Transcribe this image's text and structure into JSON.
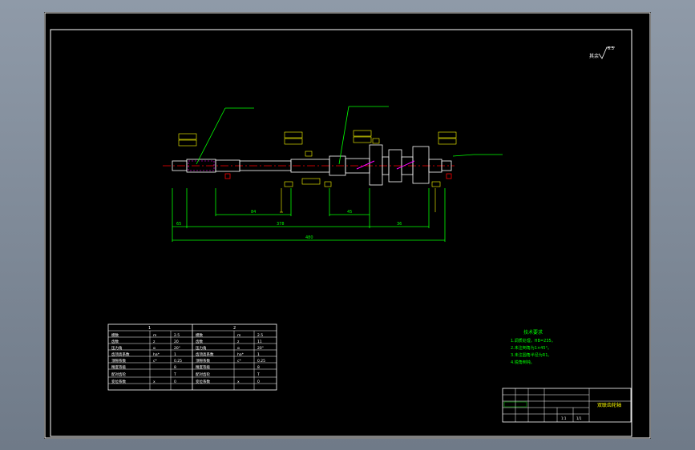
{
  "title_block": {
    "drawing_name": "双联齿轮轴",
    "scale": "1:1",
    "sheet": "1/1"
  },
  "roughness_note": "其余",
  "technical_requirements": {
    "title": "技术要求",
    "items": [
      "1.调质处理，HB=235。",
      "2.未注倒角为1×45°。",
      "3.未注圆角半径为R1。",
      "4.锐角倒钝。"
    ]
  },
  "gear_table": {
    "headers": [
      "1",
      "2"
    ],
    "rows": [
      [
        "模数",
        "m",
        "2.5",
        "模数",
        "m",
        "2.5"
      ],
      [
        "齿数",
        "z",
        "20",
        "齿数",
        "z",
        "11"
      ],
      [
        "压力角",
        "α",
        "20°",
        "压力角",
        "α",
        "20°"
      ],
      [
        "齿顶高系数",
        "ha*",
        "1",
        "齿顶高系数",
        "ha*",
        "1"
      ],
      [
        "顶隙系数",
        "c*",
        "0.25",
        "顶隙系数",
        "c*",
        "0.25"
      ],
      [
        "精度等级",
        "",
        "8",
        "精度等级",
        "",
        "8"
      ],
      [
        "配对齿轮",
        "",
        "T",
        "配对齿轮",
        "",
        "T"
      ],
      [
        "变位系数",
        "x",
        "0",
        "变位系数",
        "x",
        "0"
      ]
    ]
  },
  "dimensions": {
    "overall": "480",
    "left_segment": "65",
    "middle_segment": "378",
    "seg_a": "84",
    "seg_b": "45",
    "seg_c": "36"
  },
  "colors": {
    "frame": "#ffffff",
    "dimension": "#00ff00",
    "annotation": "#ffff00",
    "centerline": "#ff0000",
    "gear_hatch": "#ff00ff"
  }
}
